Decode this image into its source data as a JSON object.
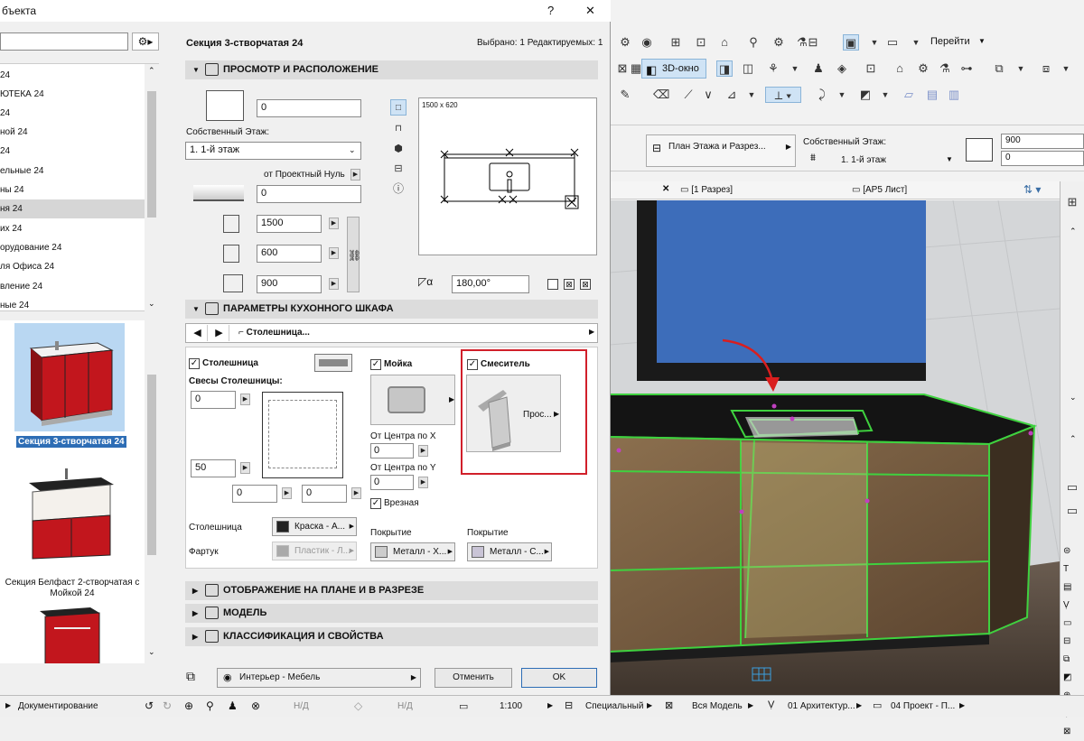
{
  "dialog": {
    "title": "бъекта",
    "help": "?",
    "close": "✕",
    "header_title": "Секция 3-створчатая 24",
    "header_info": "Выбрано: 1 Редактируемых: 1"
  },
  "left": {
    "list": [
      "24",
      "ЮТЕКА 24",
      "24",
      "ной 24",
      "24",
      "ельные 24",
      "ны 24",
      "ня 24",
      "их 24",
      "орудование 24",
      "ля Офиса 24",
      "вление 24",
      "ные 24"
    ],
    "thumb1_label": "Секция 3-створчатая 24",
    "thumb2_label": "Секция Белфаст 2-створчатая с Мойкой 24"
  },
  "sec1": {
    "title": "ПРОСМОТР И РАСПОЛОЖЕНИЕ",
    "elev_value": "0",
    "story_label": "Собственный Этаж:",
    "story_value": "1. 1-й этаж",
    "zero_label": "от Проектный Нуль",
    "zero_value": "0",
    "width": "1500",
    "depth": "600",
    "height": "900",
    "preview_size": "1500 x 620",
    "angle": "180,00°"
  },
  "sec2": {
    "title": "ПАРАМЕТРЫ КУХОННОГО ШКАФА",
    "nav_value": "Столешница...",
    "top_label": "Столешница",
    "overhang_label": "Свесы Столешницы:",
    "ov1": "0",
    "ov2": "50",
    "ov3": "0",
    "ov4": "0",
    "sink_label": "Мойка",
    "cx_label": "От Центра по X",
    "cx_value": "0",
    "cy_label": "От Центра по Y",
    "cy_value": "0",
    "inset_label": "Врезная",
    "mixer_label": "Смеситель",
    "mixer_btn": "Прос...",
    "countertop_mat_label": "Столешница",
    "countertop_mat": "Краска - А...",
    "apron_label": "Фартук",
    "apron_mat": "Пластик - Л...",
    "cover1_label": "Покрытие",
    "cover1_mat": "Металл - Х...",
    "cover2_label": "Покрытие",
    "cover2_mat": "Металл - С..."
  },
  "sec3": {
    "title": "ОТОБРАЖЕНИЕ НА ПЛАНЕ И В РАЗРЕЗЕ"
  },
  "sec4": {
    "title": "МОДЕЛЬ"
  },
  "sec5": {
    "title": "КЛАССИФИКАЦИЯ И СВОЙСТВА"
  },
  "footer": {
    "layer": "Интерьер - Мебель",
    "cancel": "Отменить",
    "ok": "OK"
  },
  "right": {
    "goto_label": "Перейти",
    "view3d": "3D-окно",
    "plan_section": "План Этажа и Разрез...",
    "story_label": "Собственный Этаж:",
    "story_value": "1. 1-й этаж",
    "height": "900",
    "elev": "0",
    "tab1": "[1 Разрез]",
    "tab2": "[АР5 Лист]"
  },
  "status": {
    "doc": "Документирование",
    "na1": "Н/Д",
    "na2": "Н/Д",
    "scale": "1:100",
    "special": "Специальный",
    "model": "Вся Модель",
    "arch": "01 Архитектур...",
    "project": "04 Проект - П..."
  }
}
